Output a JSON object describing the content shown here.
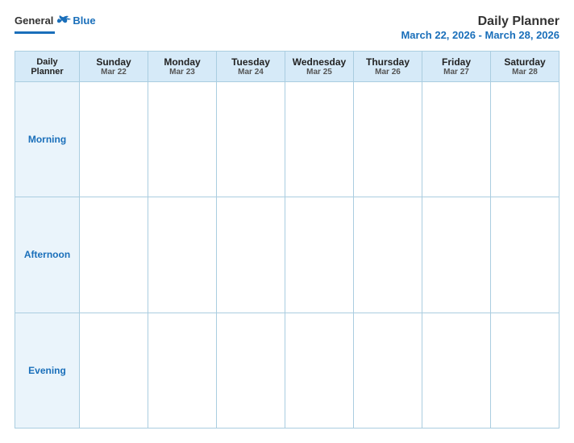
{
  "logo": {
    "general": "General",
    "blue": "Blue",
    "tagline": "Blue"
  },
  "header": {
    "title": "Daily Planner",
    "date_range": "March 22, 2026 - March 28, 2026"
  },
  "columns": [
    {
      "id": "daily-planner",
      "day": "Daily\nPlanner",
      "date": ""
    },
    {
      "id": "sunday",
      "day": "Sunday",
      "date": "Mar 22"
    },
    {
      "id": "monday",
      "day": "Monday",
      "date": "Mar 23"
    },
    {
      "id": "tuesday",
      "day": "Tuesday",
      "date": "Mar 24"
    },
    {
      "id": "wednesday",
      "day": "Wednesday",
      "date": "Mar 25"
    },
    {
      "id": "thursday",
      "day": "Thursday",
      "date": "Mar 26"
    },
    {
      "id": "friday",
      "day": "Friday",
      "date": "Mar 27"
    },
    {
      "id": "saturday",
      "day": "Saturday",
      "date": "Mar 28"
    }
  ],
  "rows": [
    {
      "id": "morning",
      "label": "Morning"
    },
    {
      "id": "afternoon",
      "label": "Afternoon"
    },
    {
      "id": "evening",
      "label": "Evening"
    }
  ]
}
